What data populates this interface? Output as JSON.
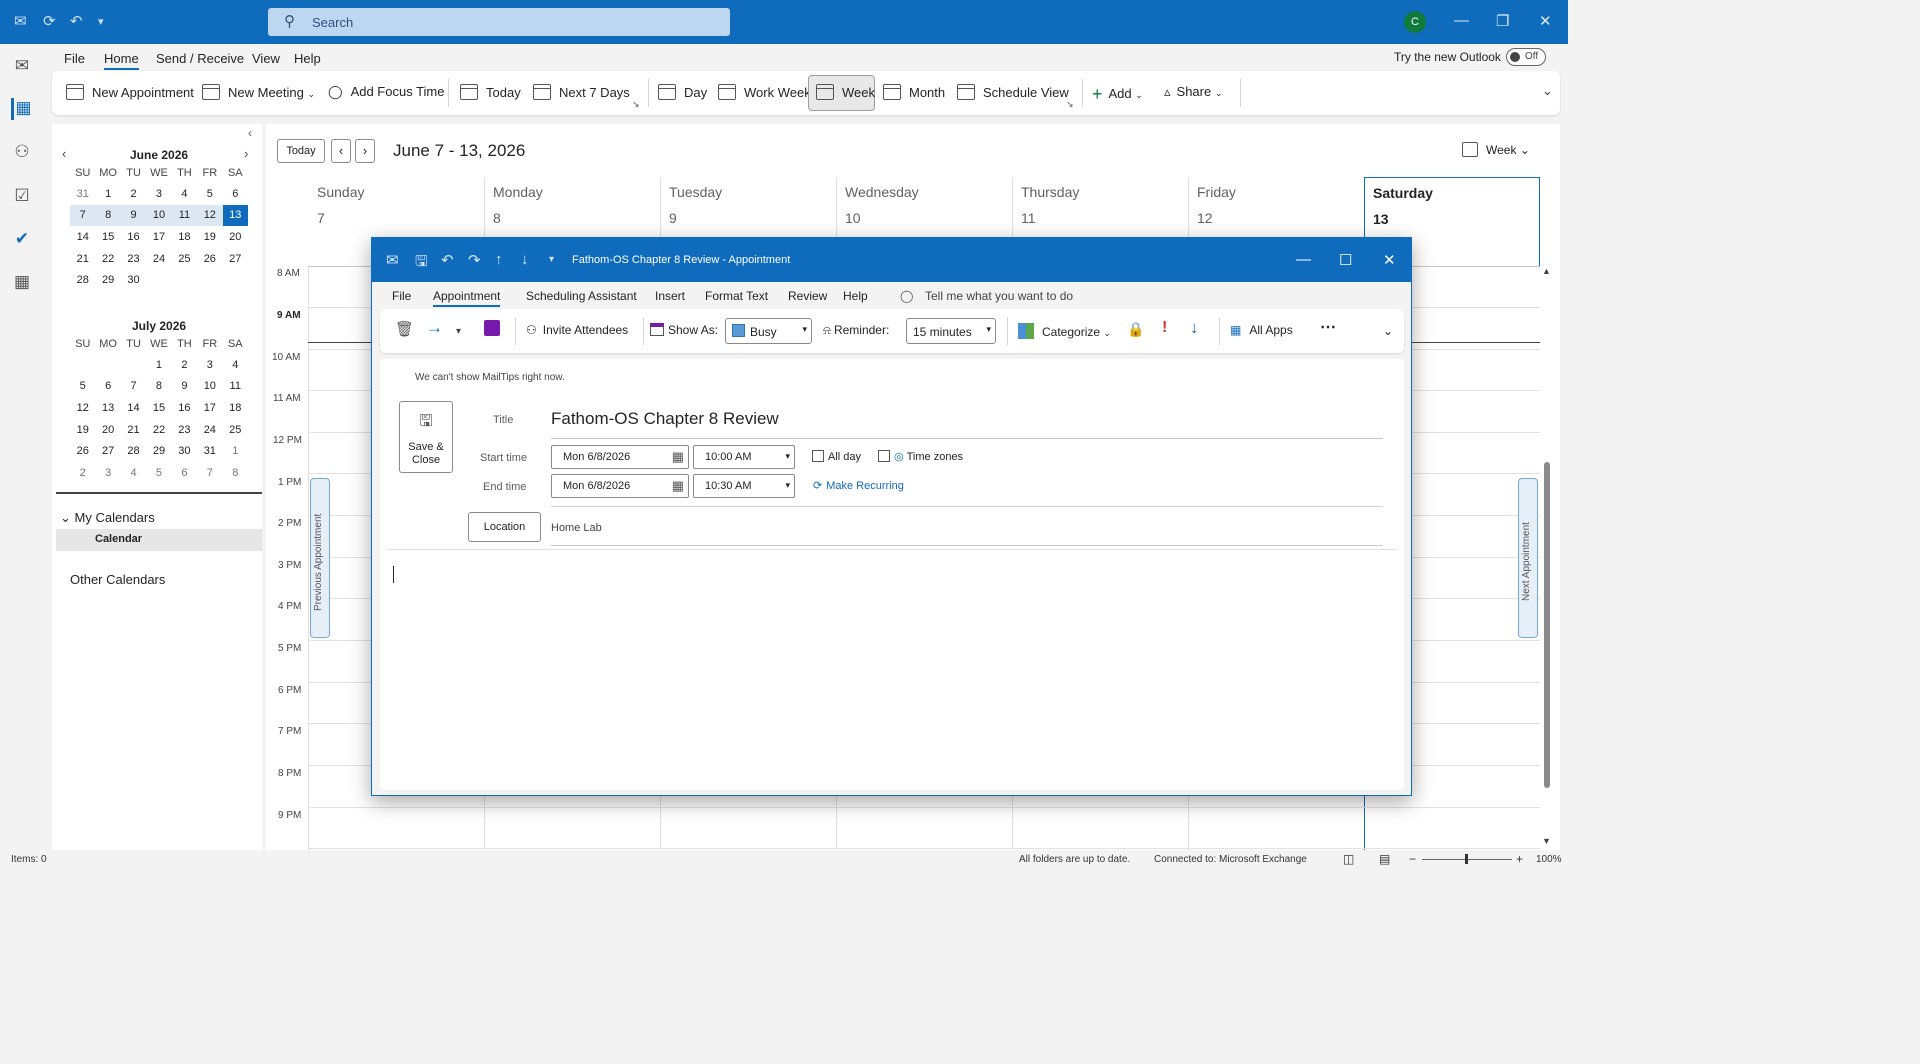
{
  "app": {
    "search_placeholder": "Search",
    "avatar_initial": "C",
    "try_new": "Try the new Outlook",
    "toggle_state": "Off"
  },
  "menu": [
    "File",
    "Home",
    "Send / Receive",
    "View",
    "Help"
  ],
  "ribbon": {
    "new_appointment": "New Appointment",
    "new_meeting": "New Meeting",
    "add_focus_time": "Add Focus Time",
    "today": "Today",
    "next7": "Next 7 Days",
    "day": "Day",
    "work_week": "Work Week",
    "week": "Week",
    "month": "Month",
    "schedule_view": "Schedule View",
    "add": "Add",
    "share": "Share"
  },
  "nav": {
    "today_btn": "Today",
    "date_range": "June 7 - 13, 2026",
    "view_mode": "Week"
  },
  "mini_cal": {
    "june_title": "June 2026",
    "july_title": "July 2026",
    "weekdays": [
      "SU",
      "MO",
      "TU",
      "WE",
      "TH",
      "FR",
      "SA"
    ],
    "june": [
      [
        "31",
        "1",
        "2",
        "3",
        "4",
        "5",
        "6"
      ],
      [
        "7",
        "8",
        "9",
        "10",
        "11",
        "12",
        "13"
      ],
      [
        "14",
        "15",
        "16",
        "17",
        "18",
        "19",
        "20"
      ],
      [
        "21",
        "22",
        "23",
        "24",
        "25",
        "26",
        "27"
      ],
      [
        "28",
        "29",
        "30",
        "",
        "",
        "",
        ""
      ]
    ],
    "july": [
      [
        "",
        "",
        "",
        "1",
        "2",
        "3",
        "4"
      ],
      [
        "5",
        "6",
        "7",
        "8",
        "9",
        "10",
        "11"
      ],
      [
        "12",
        "13",
        "14",
        "15",
        "16",
        "17",
        "18"
      ],
      [
        "19",
        "20",
        "21",
        "22",
        "23",
        "24",
        "25"
      ],
      [
        "26",
        "27",
        "28",
        "29",
        "30",
        "31",
        "1"
      ],
      [
        "2",
        "3",
        "4",
        "5",
        "6",
        "7",
        "8"
      ]
    ]
  },
  "folders": {
    "my_calendars": "My Calendars",
    "calendar": "Calendar",
    "other_calendars": "Other Calendars"
  },
  "week": {
    "days": [
      {
        "name": "Sunday",
        "date": "7"
      },
      {
        "name": "Monday",
        "date": "8"
      },
      {
        "name": "Tuesday",
        "date": "9"
      },
      {
        "name": "Wednesday",
        "date": "10"
      },
      {
        "name": "Thursday",
        "date": "11"
      },
      {
        "name": "Friday",
        "date": "12"
      },
      {
        "name": "Saturday",
        "date": "13"
      }
    ],
    "hours": [
      "8 AM",
      "9 AM",
      "10 AM",
      "11 AM",
      "12 PM",
      "1 PM",
      "2 PM",
      "3 PM",
      "4 PM",
      "5 PM",
      "6 PM",
      "7 PM",
      "8 PM",
      "9 PM"
    ],
    "previous_appointment": "Previous Appointment",
    "next_appointment": "Next Appointment"
  },
  "status": {
    "items": "Items: 0",
    "sync": "All folders are up to date.",
    "connection": "Connected to: Microsoft Exchange",
    "zoom": "100%"
  },
  "dialog": {
    "title": "Fathom-OS Chapter 8 Review  -  Appointment",
    "menu": [
      "File",
      "Appointment",
      "Scheduling Assistant",
      "Insert",
      "Format Text",
      "Review",
      "Help"
    ],
    "tell_me": "Tell me what you want to do",
    "invite": "Invite Attendees",
    "show_as_label": "Show As:",
    "show_as_value": "Busy",
    "reminder_label": "Reminder:",
    "reminder_value": "15 minutes",
    "categorize": "Categorize",
    "all_apps": "All Apps",
    "mailtips": "We can't show MailTips right now.",
    "save_close": "Save & Close",
    "title_label": "Title",
    "title_value": "Fathom-OS Chapter 8 Review",
    "start_label": "Start time",
    "start_date": "Mon 6/8/2026",
    "start_time": "10:00 AM",
    "end_label": "End time",
    "end_date": "Mon 6/8/2026",
    "end_time": "10:30 AM",
    "all_day": "All day",
    "time_zones": "Time zones",
    "make_recurring": "Make Recurring",
    "location_btn": "Location",
    "location_value": "Home Lab"
  }
}
